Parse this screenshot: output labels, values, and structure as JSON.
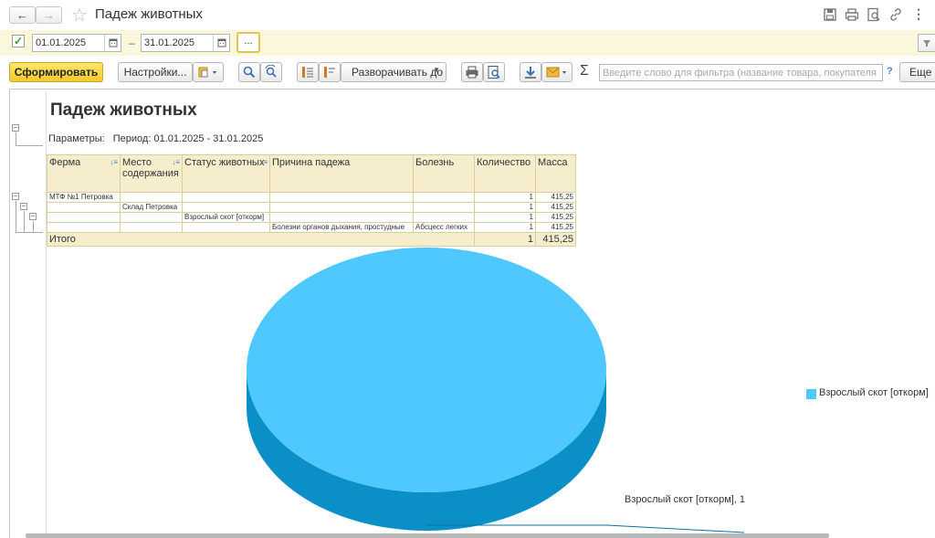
{
  "window": {
    "title": "Падеж животных"
  },
  "period": {
    "enabled": true,
    "from": "01.01.2025",
    "separator": "–",
    "to": "31.01.2025",
    "more_label": "..."
  },
  "toolbar": {
    "generate_label": "Сформировать",
    "settings_label": "Настройки...",
    "expand_label": "Разворачивать до",
    "sigma": "Σ",
    "search_placeholder": "Введите слово для фильтра (название товара, покупателя",
    "help": "?",
    "more_label": "Еще"
  },
  "report": {
    "title": "Падеж животных",
    "params_label": "Параметры:",
    "params_value": "Период: 01.01.2025 - 31.01.2025",
    "columns": [
      "Ферма",
      "Место содержания",
      "Статус животных",
      "Причина падежа",
      "Болезнь",
      "Количество",
      "Масса"
    ],
    "rows": [
      [
        "МТФ №1 Петровка",
        "",
        "",
        "",
        "",
        "1",
        "415,25"
      ],
      [
        "",
        "Склад Петровка",
        "",
        "",
        "",
        "1",
        "415,25"
      ],
      [
        "",
        "",
        "Взрослый скот [откорм]",
        "",
        "",
        "1",
        "415,25"
      ],
      [
        "",
        "",
        "",
        "Болезни органов дыхания, простудные",
        "Абсцесс легких",
        "1",
        "415,25"
      ]
    ],
    "total": {
      "label": "Итого",
      "quantity": "1",
      "mass": "415,25"
    }
  },
  "chart_data": {
    "type": "pie",
    "categories": [
      "Взрослый скот [откорм]"
    ],
    "values": [
      1
    ],
    "slice_labels": [
      "Взрослый скот [откорм], 1"
    ],
    "legend": {
      "entries": [
        "Взрослый скот [откорм]"
      ],
      "position": "right"
    },
    "colors": [
      "#4ec8ff"
    ],
    "style": "3d"
  }
}
